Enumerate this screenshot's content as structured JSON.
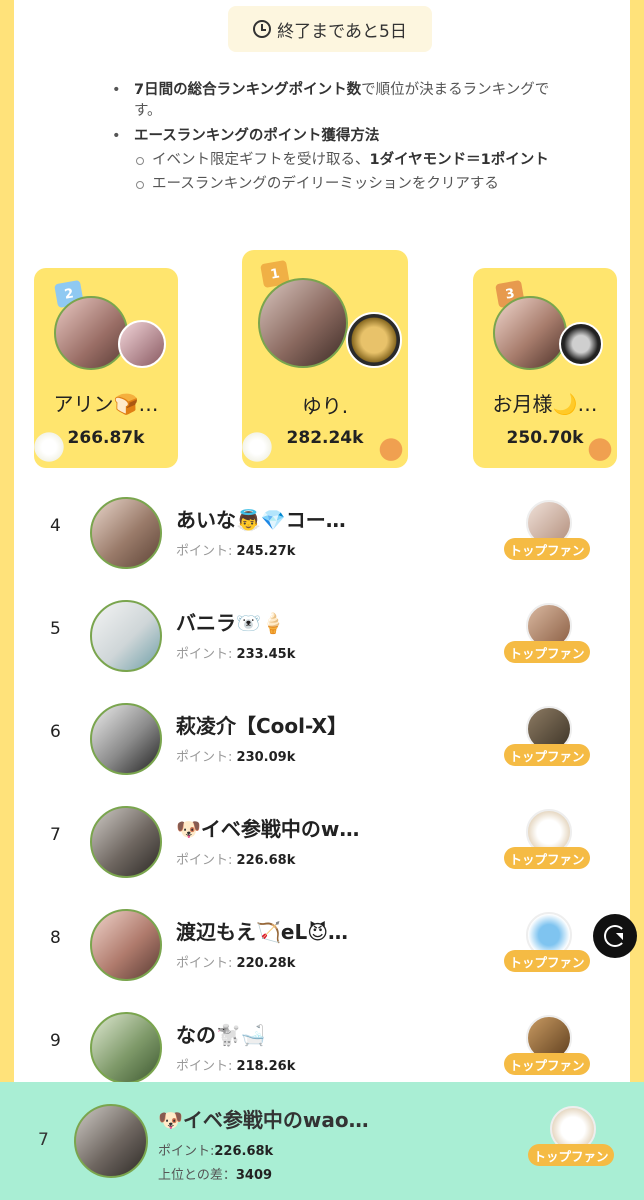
{
  "timer": {
    "icon": "clock-icon",
    "label": "終了まであと5日"
  },
  "rules": {
    "bullet1_bold": "7日間の総合ランキングポイント数",
    "bullet1_rest": "で順位が決まるランキングです。",
    "bullet2": "エースランキングのポイント獲得方法",
    "sub1_a": "イベント限定ギフトを受け取る、",
    "sub1_b": "1ダイヤモンド＝1ポイント",
    "sub2": "エースランキングのデイリーミッションをクリアする"
  },
  "podium": [
    {
      "rank": "2",
      "name": "アリン🍞…",
      "points": "266.87k"
    },
    {
      "rank": "1",
      "name": "ゆり.",
      "points": "282.24k"
    },
    {
      "rank": "3",
      "name": "お月様🌙…",
      "points": "250.70k"
    }
  ],
  "list": [
    {
      "rank": "4",
      "name": "あいな👼💎コー…",
      "points_label": "ポイント:",
      "points": "245.27k",
      "fan_label": "トップファン"
    },
    {
      "rank": "5",
      "name": "バニラ🐻‍❄️🍦",
      "points_label": "ポイント:",
      "points": "233.45k",
      "fan_label": "トップファン"
    },
    {
      "rank": "6",
      "name": "萩凌介【Cool-X】",
      "points_label": "ポイント:",
      "points": "230.09k",
      "fan_label": "トップファン"
    },
    {
      "rank": "7",
      "name": "🐶イベ参戦中のw…",
      "points_label": "ポイント:",
      "points": "226.68k",
      "fan_label": "トップファン"
    },
    {
      "rank": "8",
      "name": "渡辺もえ🏹eL😈…",
      "points_label": "ポイント:",
      "points": "220.28k",
      "fan_label": "トップファン"
    },
    {
      "rank": "9",
      "name": "なの🐩🛁",
      "points_label": "ポイント:",
      "points": "218.26k",
      "fan_label": "トップファン"
    }
  ],
  "me": {
    "rank": "7",
    "name": "🐶イベ参戦中のwao…",
    "points_label": "ポイント:",
    "points": "226.68k",
    "diff_label": "上位との差：",
    "diff": "3409",
    "fan_label": "トップファン"
  },
  "colors": {
    "accent_yellow": "#ffe56e",
    "footer_green": "#a9eed4",
    "fan_badge": "#f5bb44"
  }
}
